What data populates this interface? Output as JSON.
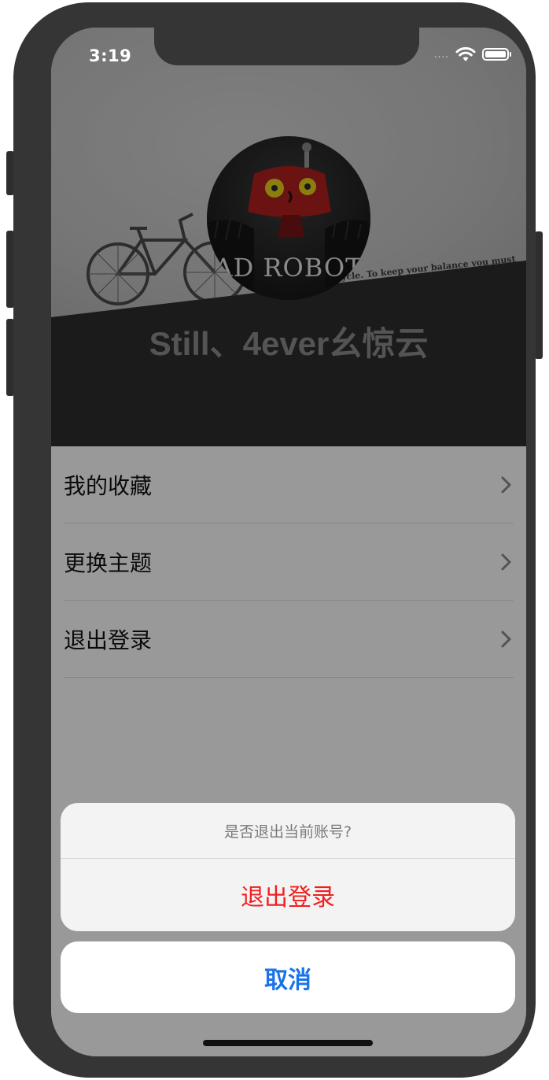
{
  "status_bar": {
    "time": "3:19",
    "signal": "....",
    "wifi_icon": "wifi-icon",
    "battery_icon": "battery-icon"
  },
  "header": {
    "avatar_text": "AD ROBOT",
    "background_text": "bicycle. To keep your balance you must",
    "username": "Still、4ever幺惊云"
  },
  "menu": {
    "items": [
      {
        "label": "我的收藏",
        "icon": "chevron-right-icon"
      },
      {
        "label": "更换主题",
        "icon": "chevron-right-icon"
      },
      {
        "label": "退出登录",
        "icon": "chevron-right-icon"
      }
    ]
  },
  "action_sheet": {
    "message": "是否退出当前账号?",
    "destructive_label": "退出登录",
    "cancel_label": "取消"
  },
  "colors": {
    "header_bg": "#2f2d2d",
    "destructive": "#f01f1f",
    "cancel": "#1a73e8",
    "frame": "#353535"
  }
}
